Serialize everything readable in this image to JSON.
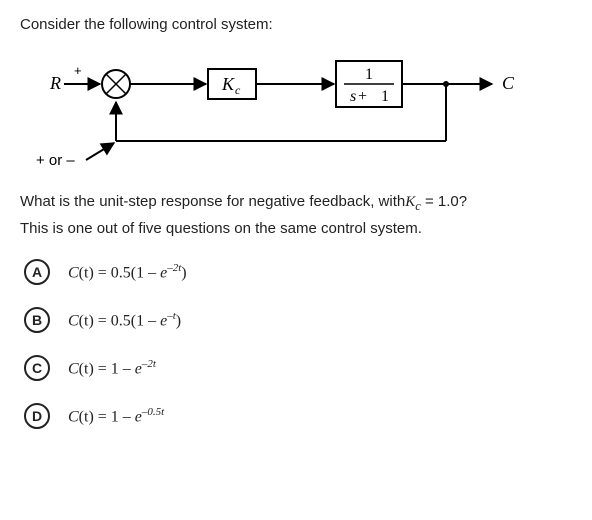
{
  "intro": "Consider the following control system:",
  "diagram": {
    "R": "R",
    "plus": "+",
    "Kc": "K",
    "Kc_sub": "c",
    "plant_num": "1",
    "plant_den_s": "s",
    "plant_den_plus": " + ",
    "plant_den_one": "1",
    "C": "C",
    "sign_label": "+ or –"
  },
  "question": {
    "prefix": "What is the unit-step response for negative feedback, with",
    "Kc_var": "K",
    "Kc_sub": "c",
    "suffix": " = 1.0?"
  },
  "note": "This is one out of five questions on the same control system.",
  "options": {
    "A": {
      "letter": "A",
      "lhs": "C",
      "lhs_arg": "(t) = 0.5(1 – ",
      "e": "e",
      "exp": "–2t",
      "tail": ")"
    },
    "B": {
      "letter": "B",
      "lhs": "C",
      "lhs_arg": "(t) = 0.5(1 – ",
      "e": "e",
      "exp": "–t",
      "tail": ")"
    },
    "C": {
      "letter": "C",
      "lhs": "C",
      "lhs_arg": "(t) = 1 – ",
      "e": "e",
      "exp": "–2t",
      "tail": ""
    },
    "D": {
      "letter": "D",
      "lhs": "C",
      "lhs_arg": "(t) = 1 – ",
      "e": "e",
      "exp": "–0.5t",
      "tail": ""
    }
  }
}
